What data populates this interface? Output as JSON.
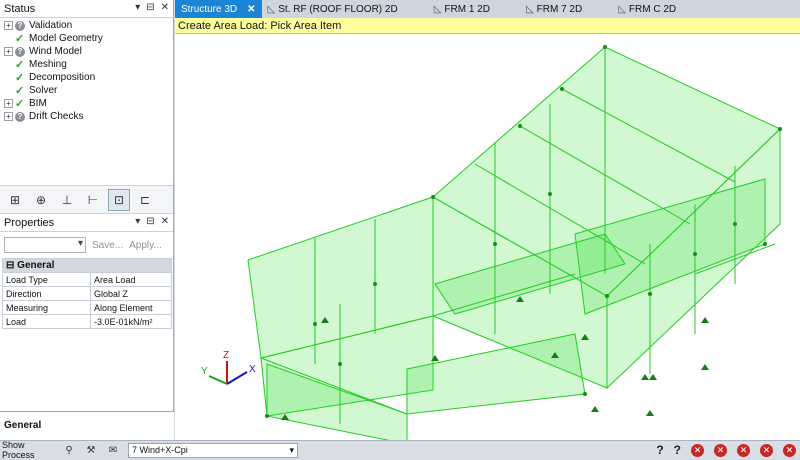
{
  "status_panel": {
    "title": "Status",
    "items": [
      {
        "label": "Validation",
        "state": "question",
        "expandable": true
      },
      {
        "label": "Model Geometry",
        "state": "check",
        "expandable": false
      },
      {
        "label": "Wind Model",
        "state": "question",
        "expandable": true
      },
      {
        "label": "Meshing",
        "state": "check",
        "expandable": false
      },
      {
        "label": "Decomposition",
        "state": "check",
        "expandable": false
      },
      {
        "label": "Solver",
        "state": "check",
        "expandable": false
      },
      {
        "label": "BIM",
        "state": "check",
        "expandable": true
      },
      {
        "label": "Drift Checks",
        "state": "question",
        "expandable": true
      }
    ]
  },
  "properties_panel": {
    "title": "Properties",
    "save_label": "Save...",
    "apply_label": "Apply...",
    "group": "General",
    "rows": [
      {
        "key": "Load Type",
        "value": "Area Load"
      },
      {
        "key": "Direction",
        "value": "Global Z"
      },
      {
        "key": "Measuring",
        "value": "Along Element"
      },
      {
        "key": "Load",
        "value": "-3.0E-01kN/m²"
      }
    ],
    "footer_label": "General"
  },
  "tabs": [
    {
      "label": "Structure 3D",
      "active": true
    },
    {
      "label": "St. RF (ROOF FLOOR) 2D",
      "active": false
    },
    {
      "label": "FRM 1 2D",
      "active": false
    },
    {
      "label": "FRM 7 2D",
      "active": false
    },
    {
      "label": "FRM C 2D",
      "active": false
    }
  ],
  "prompt_text": "Create Area Load: Pick Area Item",
  "axes": {
    "x": "X",
    "y": "Y",
    "z": "Z"
  },
  "statusbar": {
    "show_process_label": "Show Process",
    "load_case": "7 Wind+X-Cpi"
  },
  "colors": {
    "accent": "#1c84d4",
    "model_green": "#22dd22",
    "prompt_bg": "#ffff9e"
  }
}
